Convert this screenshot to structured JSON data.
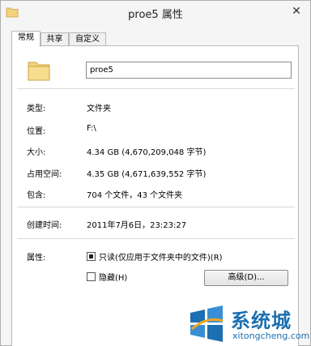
{
  "window": {
    "title": "proe5 属性",
    "close_glyph": "✕"
  },
  "tabs": [
    {
      "label": "常规",
      "active": true
    },
    {
      "label": "共享",
      "active": false
    },
    {
      "label": "自定义",
      "active": false
    }
  ],
  "general": {
    "name_value": "proe5",
    "type_label": "类型:",
    "type_value": "文件夹",
    "location_label": "位置:",
    "location_value": "F:\\",
    "size_label": "大小:",
    "size_value": "4.34 GB (4,670,209,048 字节)",
    "size_on_disk_label": "占用空间:",
    "size_on_disk_value": "4.35 GB (4,671,639,552 字节)",
    "contains_label": "包含:",
    "contains_value": "704 个文件，43 个文件夹",
    "created_label": "创建时间:",
    "created_value": "2011年7月6日，23:23:27",
    "attributes_label": "属性:",
    "readonly_label": "只读(仅应用于文件夹中的文件)(R)",
    "readonly_checked": true,
    "hidden_label": "隐藏(H)",
    "hidden_checked": false,
    "advanced_button_label": "高级(D)..."
  },
  "watermark": {
    "name_cn": "系统城",
    "name_en": "xitongcheng.com"
  },
  "colors": {
    "folder_yellow": "#f3d27a",
    "watermark_blue": "#1c6fb0"
  }
}
